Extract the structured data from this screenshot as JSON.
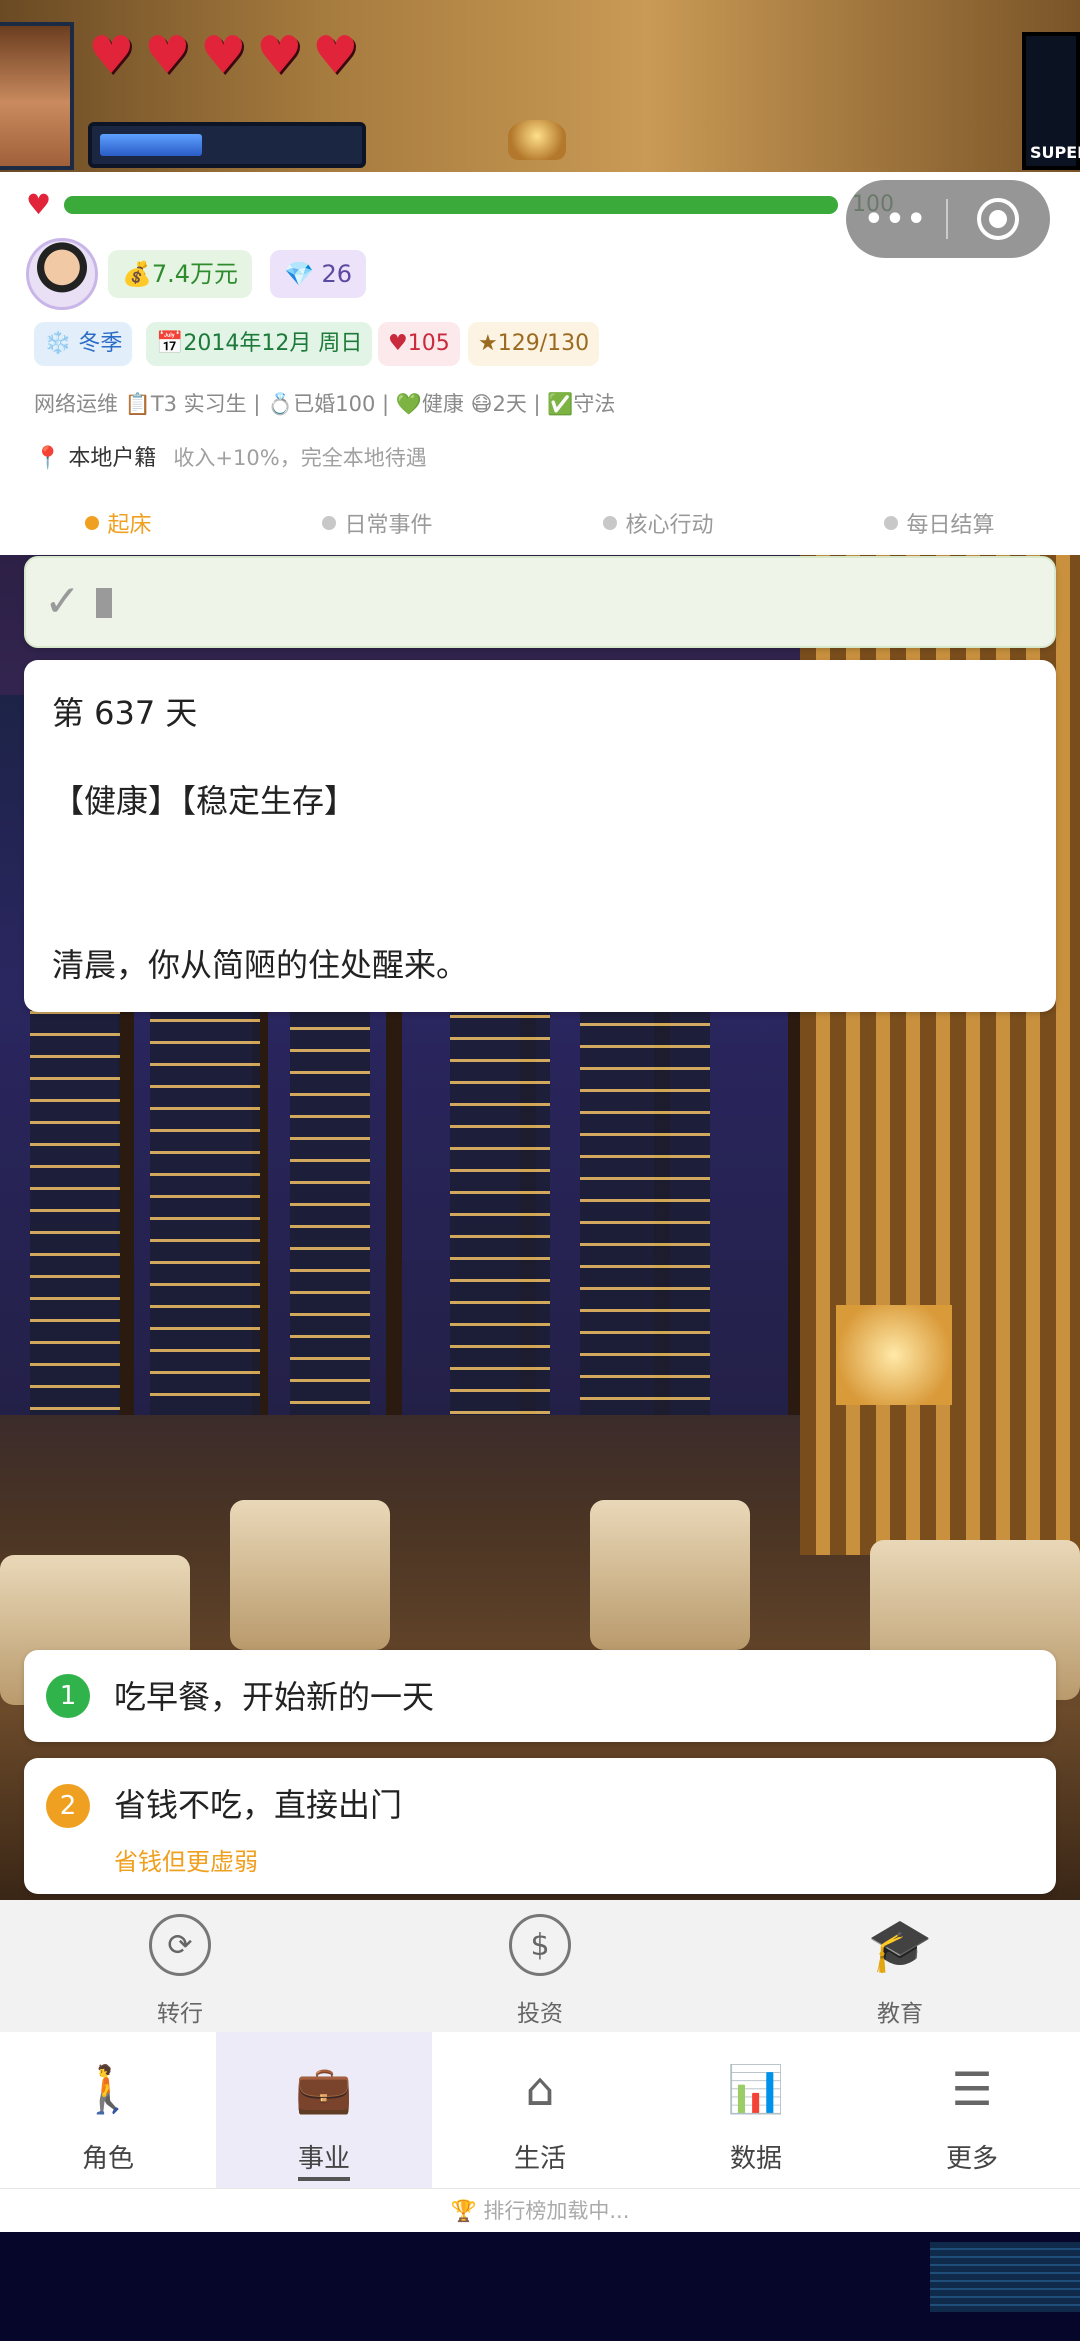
{
  "banner": {
    "hearts": [
      "♥",
      "♥",
      "♥",
      "♥",
      "♥"
    ],
    "energy_fraction": 0.4,
    "corner_label": "SUPER"
  },
  "header": {
    "health_value": "100",
    "health_fraction": 1.0,
    "capsule": {
      "more": "•••"
    },
    "money": "💰7.4万元",
    "gems": "💎 26",
    "season": "❄️ 冬季",
    "date": "📅2014年12月 周日",
    "hearts": "♥105",
    "stars": "★129/130",
    "status_line": "  网络运维 📋T3 实习生 | 💍已婚100 | 💚健康 😷2天 | ✅守法",
    "hukou": {
      "pin": "📍",
      "name": "本地户籍",
      "desc": "收入+10%，完全本地待遇"
    }
  },
  "steps": [
    {
      "label": "起床",
      "active": true
    },
    {
      "label": "日常事件",
      "active": false
    },
    {
      "label": "核心行动",
      "active": false
    },
    {
      "label": "每日结算",
      "active": false
    }
  ],
  "check_card": {
    "mark": "✓"
  },
  "story": {
    "day": "第 637 天",
    "tags": "【健康】【稳定生存】",
    "text": "清晨，你从简陋的住处醒来。"
  },
  "choices": [
    {
      "num": "1",
      "text": "吃早餐，开始新的一天"
    },
    {
      "num": "2",
      "text": "省钱不吃，直接出门",
      "sub": "省钱但更虚弱"
    }
  ],
  "submenu": [
    {
      "label": "转行",
      "icon": "career-switch-icon"
    },
    {
      "label": "投资",
      "icon": "investment-icon"
    },
    {
      "label": "教育",
      "icon": "graduation-cap-icon"
    }
  ],
  "nav": [
    {
      "label": "角色",
      "icon": "walking-person-icon",
      "active": false
    },
    {
      "label": "事业",
      "icon": "briefcase-icon",
      "active": true
    },
    {
      "label": "生活",
      "icon": "house-icon",
      "active": false
    },
    {
      "label": "数据",
      "icon": "bar-chart-icon",
      "active": false
    },
    {
      "label": "更多",
      "icon": "list-icon",
      "active": false
    }
  ],
  "rank": "🏆 排行榜加载中..."
}
